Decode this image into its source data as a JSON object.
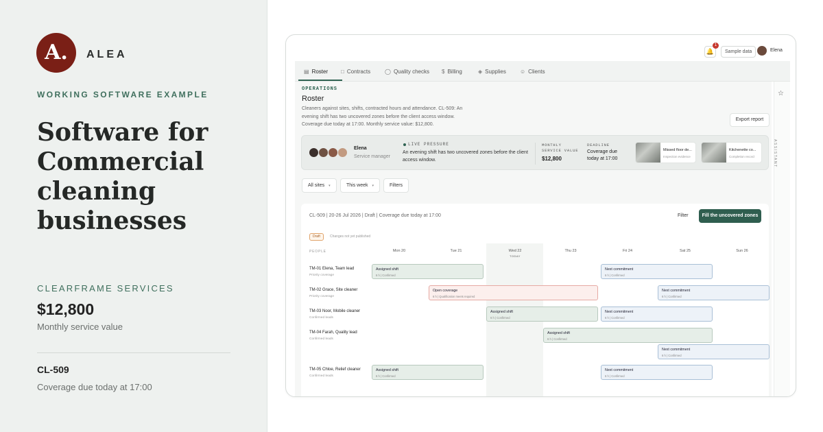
{
  "brand": {
    "logo_letter": "A.",
    "name": "ALEA"
  },
  "hero": {
    "eyebrow": "WORKING SOFTWARE EXAMPLE",
    "headline": "Software for Commercial cleaning businesses",
    "company": "CLEARFRAME SERVICES",
    "value": "$12,800",
    "value_label": "Monthly service value",
    "contract_id": "CL-509",
    "contract_due": "Coverage due today at 17:00"
  },
  "topbar": {
    "notif_count": "1",
    "sample": "Sample data",
    "user": "Elena"
  },
  "nav": {
    "tabs": [
      {
        "label": "Roster",
        "icon": "calendar-icon"
      },
      {
        "label": "Contracts",
        "icon": "document-icon"
      },
      {
        "label": "Quality checks",
        "icon": "shield-icon"
      },
      {
        "label": "Billing",
        "icon": "dollar-icon"
      },
      {
        "label": "Supplies",
        "icon": "box-icon"
      },
      {
        "label": "Clients",
        "icon": "users-icon"
      }
    ]
  },
  "page": {
    "eyebrow": "OPERATIONS",
    "title": "Roster",
    "description": "Cleaners against sites, shifts, contracted hours and attendance. CL-509: An evening shift has two uncovered zones before the client access window. Coverage due today at 17:00. Monthly service value: $12,800.",
    "export": "Export report"
  },
  "pressure": {
    "manager_name": "Elena",
    "manager_role": "Service manager",
    "live_label": "LIVE PRESSURE",
    "live_text": "An evening shift has two uncovered zones before the client access window.",
    "msv_label": "MONTHLY SERVICE VALUE",
    "msv_value": "$12,800",
    "deadline_label": "DEADLINE",
    "deadline_text": "Coverage due today at 17:00",
    "thumbs": [
      {
        "title": "Missed floor de...",
        "sub": "Inspection evidence"
      },
      {
        "title": "Kitchenette co...",
        "sub": "Completion record"
      }
    ]
  },
  "filters": {
    "sites": "All sites",
    "week": "This week",
    "filters": "Filters"
  },
  "roster": {
    "header": "CL-509 | 20-26 Jul 2026 | Draft | Coverage due today at 17:00",
    "filter": "Filter",
    "fill_button": "Fill the uncovered zones",
    "draft_badge": "Draft",
    "draft_note": "Changes not yet published",
    "people_header": "PEOPLE",
    "days": [
      "Mon 20",
      "Tue 21",
      "Wed 22",
      "Thu 23",
      "Fri 24",
      "Sat 25",
      "Sun 26"
    ],
    "today_label": "TODAY",
    "people": [
      {
        "name": "TM-01 Elena, Team lead",
        "sub": "Priority coverage"
      },
      {
        "name": "TM-02 Grace, Site cleaner",
        "sub": "Priority coverage"
      },
      {
        "name": "TM-03 Noor, Mobile cleaner",
        "sub": "Confirmed leads"
      },
      {
        "name": "TM-04 Farah, Quality lead",
        "sub": "Confirmed leads"
      },
      {
        "name": "TM-05 Chloe, Relief cleaner",
        "sub": "Confirmed leads"
      }
    ],
    "shifts": [
      {
        "title": "Assigned shift",
        "meta": "6 h | Confirmed"
      },
      {
        "title": "Next commitment",
        "meta": "6 h | Confirmed"
      },
      {
        "title": "Open coverage",
        "meta": "6 h | Qualification meets required"
      },
      {
        "title": "Next commitment",
        "meta": "6 h | Confirmed"
      },
      {
        "title": "Assigned shift",
        "meta": "6 h | Confirmed"
      },
      {
        "title": "Next commitment",
        "meta": "6 h | Confirmed"
      },
      {
        "title": "Assigned shift",
        "meta": "6 h | Confirmed"
      },
      {
        "title": "Next commitment",
        "meta": "6 h | Confirmed"
      },
      {
        "title": "Assigned shift",
        "meta": "6 h | Confirmed"
      },
      {
        "title": "Next commitment",
        "meta": "6 h | Confirmed"
      }
    ]
  },
  "assistant": {
    "label": "ASSISTANT"
  },
  "colors": {
    "accent": "#2f5e4f",
    "brand": "#7a1f16",
    "open": "#e6a9a3"
  }
}
